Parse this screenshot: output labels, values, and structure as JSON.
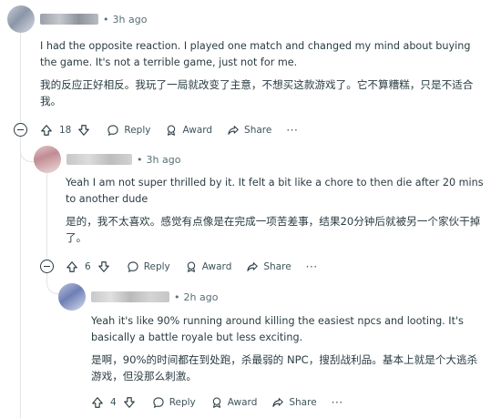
{
  "comments": [
    {
      "time_ago": "3h ago",
      "text_en": "I had the opposite reaction. I played one match and changed my mind about buying the game. It's not a terrible game, just not for me.",
      "text_zh": "我的反应正好相反。我玩了一局就改变了主意，不想买这款游戏了。它不算糟糕，只是不适合我。",
      "votes": "18"
    },
    {
      "time_ago": "3h ago",
      "text_en": "Yeah I am not super thrilled by it. It felt a bit like a chore to then die after 20 mins to another dude",
      "text_zh": "是的，我不太喜欢。感觉有点像是在完成一项苦差事，结果20分钟后就被另一个家伙干掉了。",
      "votes": "6"
    },
    {
      "time_ago": "2h ago",
      "text_en": "Yeah it's like 90% running around killing the easiest npcs and looting. It's basically a battle royale but less exciting.",
      "text_zh": "是啊，90%的时间都在到处跑，杀最弱的 NPC，搜刮战利品。基本上就是个大逃杀游戏，但没那么刺激。",
      "votes": "4"
    }
  ],
  "actions": {
    "reply": "Reply",
    "award": "Award",
    "share": "Share",
    "more": "···"
  },
  "separator": "•",
  "colors": {
    "meta_text": "#576f76",
    "body_text": "#2a3c42",
    "thread_line": "#e1e4e6"
  },
  "icons": [
    "upvote-icon",
    "downvote-icon",
    "reply-bubble-icon",
    "award-icon",
    "share-arrow-icon",
    "collapse-minus-icon"
  ]
}
